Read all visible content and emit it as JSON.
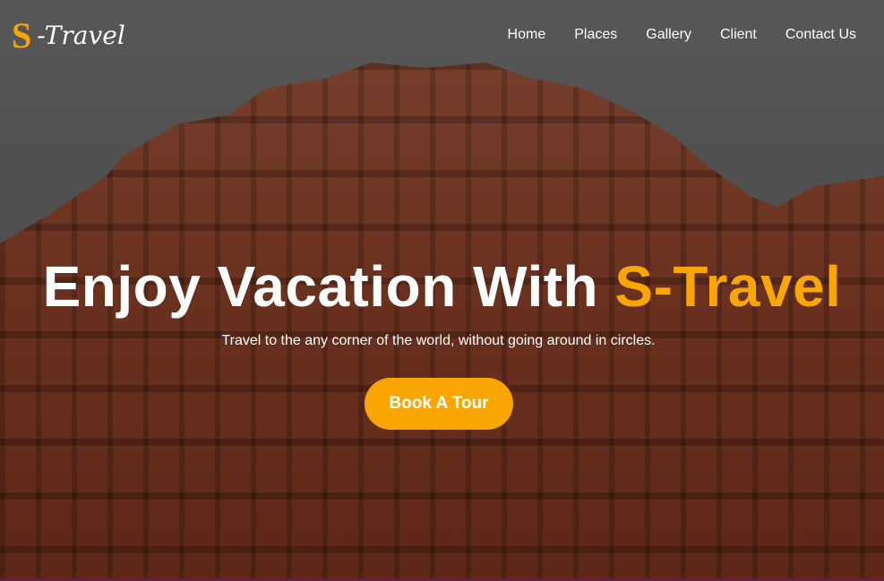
{
  "logo": {
    "letter": "S",
    "text": "-Travel"
  },
  "nav": {
    "items": [
      "Home",
      "Places",
      "Gallery",
      "Client",
      "Contact Us"
    ]
  },
  "hero": {
    "title_main": "Enjoy Vacation With ",
    "title_accent": "S-Travel",
    "subtitle": "Travel to the any corner of the world, without going around in circles.",
    "cta": "Book A Tour"
  },
  "colors": {
    "accent": "#f9a602",
    "footer_strip": "#6b1f3a"
  }
}
